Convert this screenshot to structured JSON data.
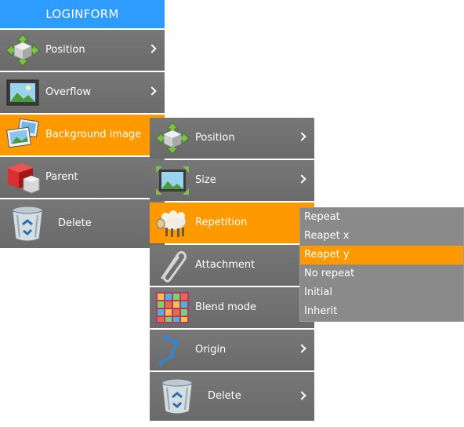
{
  "menu1": {
    "header": "LOGINFORM",
    "items": [
      {
        "label": "Position",
        "icon": "move-arrows-icon",
        "has_submenu": true
      },
      {
        "label": "Overflow",
        "icon": "picture-icon",
        "has_submenu": true
      },
      {
        "label": "Background image",
        "icon": "image-stack-icon",
        "active": true
      },
      {
        "label": "Parent",
        "icon": "cubes-icon"
      },
      {
        "label": "Delete",
        "icon": "recycle-bin-icon"
      }
    ]
  },
  "menu2": {
    "items": [
      {
        "label": "Position",
        "icon": "move-arrows-icon",
        "has_submenu": true
      },
      {
        "label": "Size",
        "icon": "resize-picture-icon",
        "has_submenu": true
      },
      {
        "label": "Repetition",
        "icon": "sheep-icon",
        "active": true
      },
      {
        "label": "Attachment",
        "icon": "paperclip-icon"
      },
      {
        "label": "Blend mode",
        "icon": "color-grid-icon"
      },
      {
        "label": "Origin",
        "icon": "path-nodes-icon",
        "has_submenu": true
      },
      {
        "label": "Delete",
        "icon": "recycle-bin-icon",
        "has_submenu": true
      }
    ]
  },
  "menu3": {
    "options": [
      "Repeat",
      "Reapet x",
      "Reapet y",
      "No repeat",
      "Initial",
      "Inherit"
    ],
    "selected": "Reapet y"
  },
  "colors": {
    "header": "#2e9cff",
    "active": "#ff9900",
    "item_bg": "#707070",
    "options_bg": "#8a8a8a"
  }
}
